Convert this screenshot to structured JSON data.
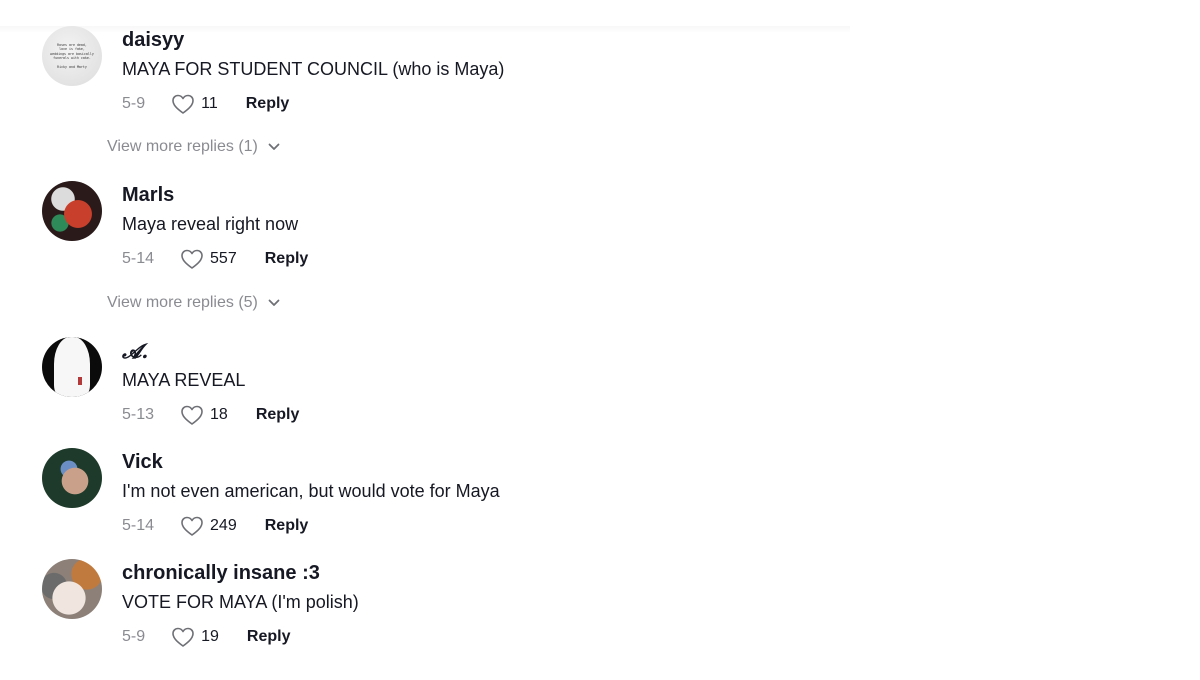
{
  "comments": [
    {
      "username": "daisyy",
      "text": "MAYA FOR STUDENT COUNCIL (who is Maya)",
      "date": "5-9",
      "likes": "11",
      "reply_label": "Reply",
      "avatar_text": "Roses are dead,\nlove is fake,\nweddings are basically\nfunerals with cake.\n\nRicky and Marty",
      "view_more": "View more replies (1)"
    },
    {
      "username": "Marls",
      "text": "Maya reveal right now",
      "date": "5-14",
      "likes": "557",
      "reply_label": "Reply",
      "view_more": "View more replies (5)"
    },
    {
      "username": "𝓐.",
      "text": "MAYA REVEAL",
      "date": "5-13",
      "likes": "18",
      "reply_label": "Reply"
    },
    {
      "username": "Vick",
      "text": "I'm not even american, but would vote for Maya",
      "date": "5-14",
      "likes": "249",
      "reply_label": "Reply"
    },
    {
      "username": "chronically insane :3",
      "text": "VOTE FOR MAYA (I'm polish)",
      "date": "5-9",
      "likes": "19",
      "reply_label": "Reply"
    }
  ],
  "icons": {
    "like": "heart-outline-icon",
    "expand": "chevron-down-icon"
  },
  "colors": {
    "primary_text": "#161823",
    "secondary_text": "#8a8b91",
    "background": "#ffffff"
  }
}
